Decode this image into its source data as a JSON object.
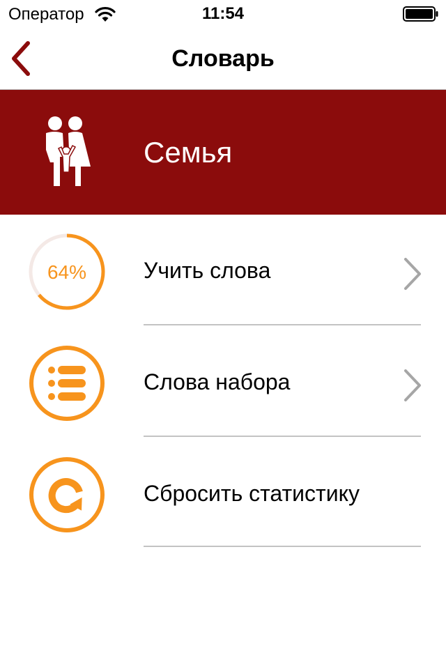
{
  "status_bar": {
    "carrier": "Оператор",
    "time": "11:54",
    "wifi_icon": "wifi-icon",
    "battery_icon": "battery-icon"
  },
  "nav": {
    "title": "Словарь",
    "back_icon": "chevron-left-icon"
  },
  "banner": {
    "title": "Семья",
    "icon": "family-icon"
  },
  "colors": {
    "accent": "#f7941d",
    "banner": "#8b0c0c",
    "back": "#8b0c0c",
    "chevron": "#a6a6a6",
    "separator": "#c3c3c3"
  },
  "rows": [
    {
      "label": "Учить слова",
      "icon": "progress-ring-icon",
      "progress_text": "64%",
      "progress": 0.64,
      "has_chevron": true
    },
    {
      "label": "Слова набора",
      "icon": "list-icon",
      "has_chevron": true
    },
    {
      "label": "Сбросить статистику",
      "icon": "reset-icon",
      "has_chevron": false
    }
  ]
}
